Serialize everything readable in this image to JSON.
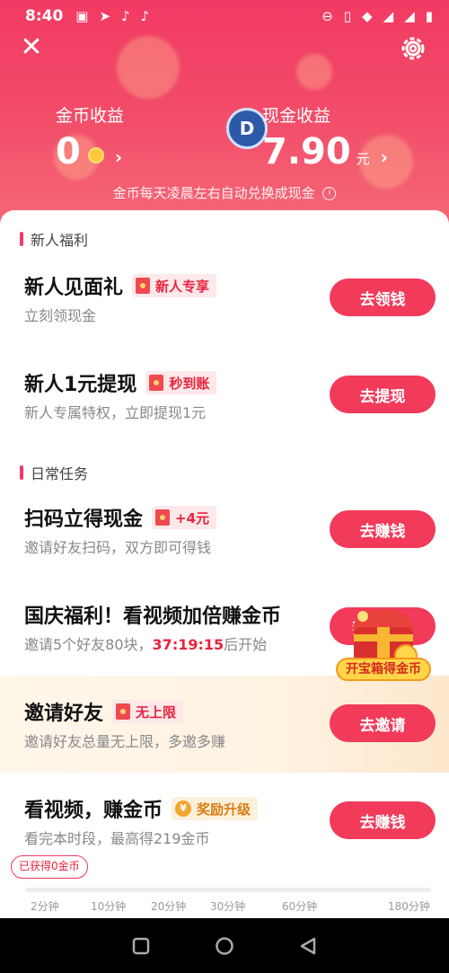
{
  "status_bar": {
    "time": "8:40"
  },
  "header": {
    "coin_label": "金币收益",
    "coin_value": "0",
    "cash_label": "现金收益",
    "cash_value": "7.90",
    "cash_unit": "元",
    "badge_letter": "D",
    "hint": "金币每天凌晨左右自动兑换成现金",
    "colors": {
      "brand": "#f23a63"
    }
  },
  "sections": {
    "newbie_title": "新人福利",
    "daily_title": "日常任务"
  },
  "tasks": [
    {
      "title": "新人见面礼",
      "tag": "新人专享",
      "sub": "立刻领现金",
      "button": "去领钱"
    },
    {
      "title": "新人1元提现",
      "tag": "秒到账",
      "sub": "新人专属特权，立即提现1元",
      "button": "去提现"
    },
    {
      "title": "扫码立得现金",
      "tag": "+4元",
      "sub": "邀请好友扫码，双方即可得钱",
      "button": "去赚钱"
    },
    {
      "title": "国庆福利！看视频加倍赚金币",
      "sub_prefix": "邀请5个好友80块，",
      "countdown": "37:19:15",
      "sub_suffix": "后开始",
      "button": "我要预约"
    },
    {
      "title": "邀请好友",
      "tag": "无上限",
      "sub": "邀请好友总量无上限，多邀多赚",
      "button": "去邀请"
    },
    {
      "title": "看视频，赚金币",
      "tag": "奖励升级",
      "sub": "看完本时段，最高得219金币",
      "button": "去赚钱"
    }
  ],
  "progress": {
    "earned_label": "已获得0金币",
    "ticks": [
      "2分钟",
      "10分钟",
      "20分钟",
      "30分钟",
      "60分钟",
      "180分钟"
    ],
    "fraction": 0
  },
  "chest": {
    "label": "开宝箱得金币"
  },
  "icons": [
    "close-icon",
    "gear-icon",
    "info-icon",
    "coin-icon",
    "red-envelope-icon",
    "yen-coin-icon",
    "treasure-chest-icon"
  ]
}
